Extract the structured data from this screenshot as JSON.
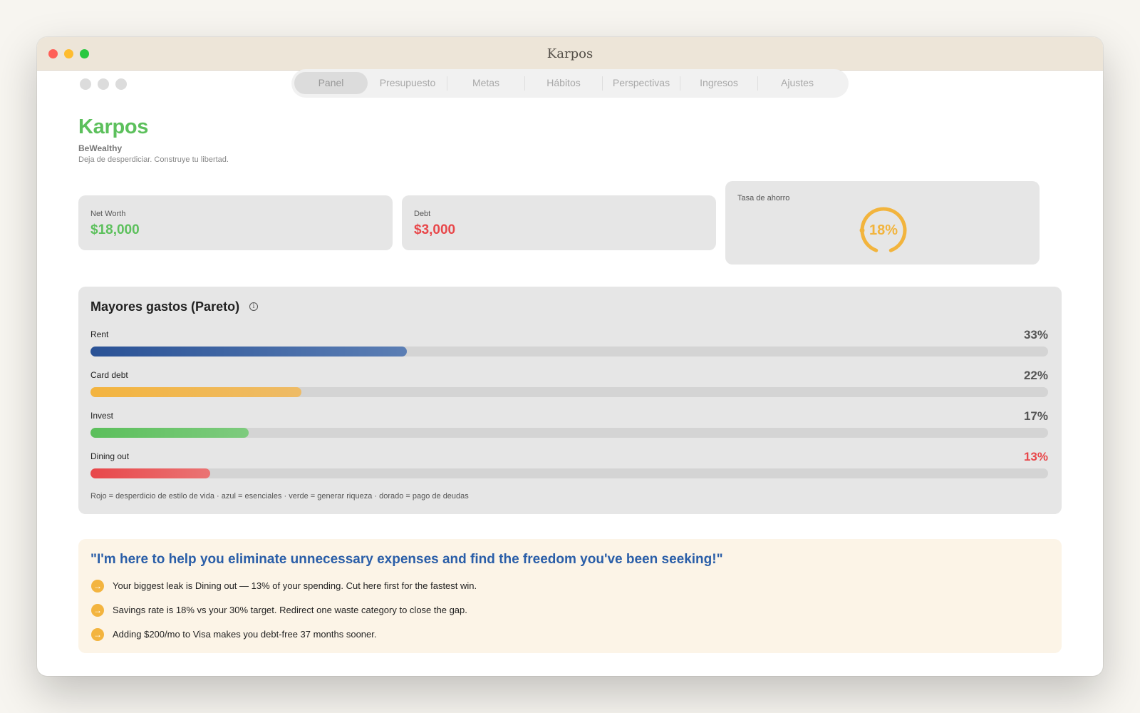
{
  "window": {
    "title": "Karpos"
  },
  "tabs": [
    {
      "label": "Panel",
      "active": true
    },
    {
      "label": "Presupuesto"
    },
    {
      "label": "Metas"
    },
    {
      "label": "Hábitos"
    },
    {
      "label": "Perspectivas"
    },
    {
      "label": "Ingresos"
    },
    {
      "label": "Ajustes"
    }
  ],
  "brand": {
    "title": "Karpos",
    "subtitle": "BeWealthy",
    "tagline": "Deja de desperdiciar. Construye tu libertad."
  },
  "cards": {
    "net_worth": {
      "label": "Net Worth",
      "value": "$18,000",
      "color": "#5cc05c"
    },
    "debt": {
      "label": "Debt",
      "value": "$3,000",
      "color": "#e8474a"
    },
    "savings": {
      "label": "Tasa de ahorro",
      "value": "18%",
      "fraction": 0.18,
      "color": "#f2b43d"
    }
  },
  "pareto": {
    "title": "Mayores gastos (Pareto)",
    "info_icon": "info-icon",
    "items": [
      {
        "label": "Rent",
        "pct": "33%",
        "fraction": 0.33,
        "color_from": "#2a5296",
        "color_to": "#5b7eb4",
        "pct_color": "#555555"
      },
      {
        "label": "Card debt",
        "pct": "22%",
        "fraction": 0.22,
        "color_from": "#f3b43f",
        "color_to": "#eebb66",
        "pct_color": "#555555"
      },
      {
        "label": "Invest",
        "pct": "17%",
        "fraction": 0.165,
        "color_from": "#5bbf5b",
        "color_to": "#7ecb7e",
        "pct_color": "#555555"
      },
      {
        "label": "Dining out",
        "pct": "13%",
        "fraction": 0.125,
        "color_from": "#e8474a",
        "color_to": "#ea7474",
        "pct_color": "#e8474a"
      }
    ],
    "legend": "Rojo = desperdicio de estilo de vida · azul = esenciales · verde = generar riqueza · dorado = pago de deudas"
  },
  "coach": {
    "quote": "\"I'm here to help you eliminate unnecessary expenses and find the freedom you've been seeking!\"",
    "tip_icon": "arrow-right-circle-icon",
    "tips": [
      "Your biggest leak is Dining out — 13% of your spending. Cut here first for the fastest win.",
      "Savings rate is 18% vs your 30% target. Redirect one waste category to close the gap.",
      "Adding $200/mo to Visa makes you debt-free 37 months sooner."
    ]
  }
}
